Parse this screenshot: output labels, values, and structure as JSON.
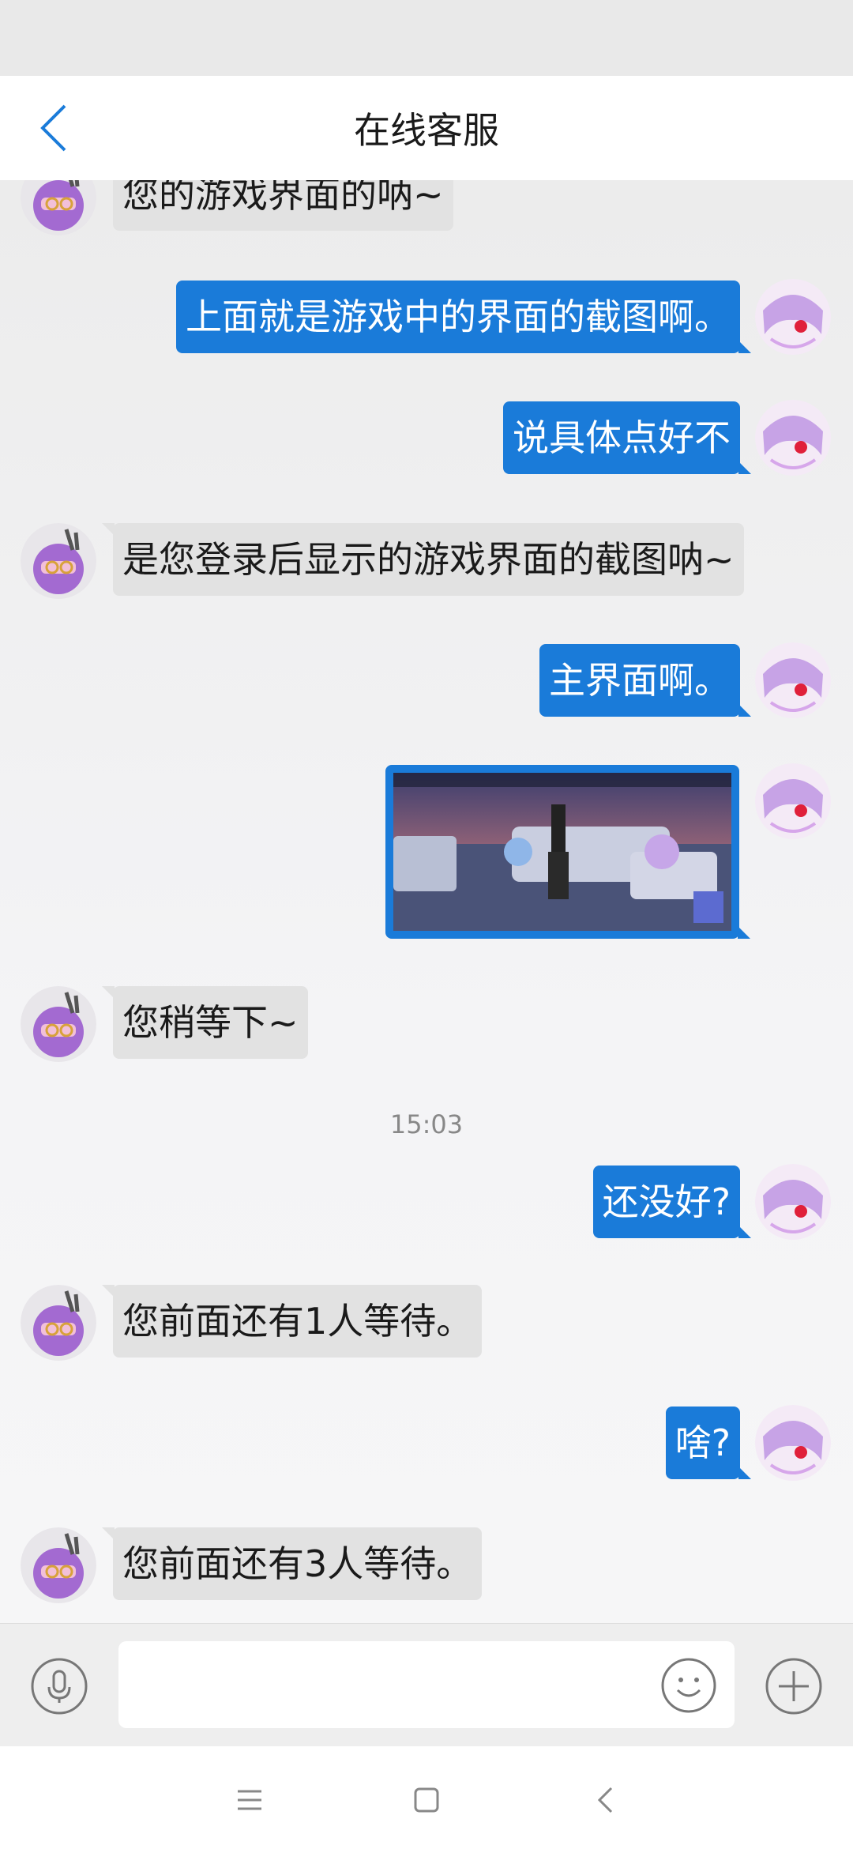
{
  "header": {
    "title": "在线客服"
  },
  "messages": [
    {
      "side": "left",
      "text": "您的游戏界面的呐~"
    },
    {
      "side": "right",
      "text": "上面就是游戏中的界面的截图啊。"
    },
    {
      "side": "right",
      "text": "说具体点好不"
    },
    {
      "side": "left",
      "text": "是您登录后显示的游戏界面的截图呐~"
    },
    {
      "side": "right",
      "text": "主界面啊。"
    },
    {
      "side": "right",
      "type": "image"
    },
    {
      "side": "left",
      "text": "您稍等下~"
    },
    {
      "timestamp": "15:03"
    },
    {
      "side": "right",
      "text": "还没好?"
    },
    {
      "side": "left",
      "text": "您前面还有1人等待。"
    },
    {
      "side": "right",
      "text": "啥?"
    },
    {
      "side": "left",
      "text": "您前面还有3人等待。"
    }
  ],
  "input": {
    "value": "",
    "placeholder": ""
  },
  "icons": {
    "back": "chevron-left-icon",
    "mic": "microphone-icon",
    "emoji": "smiley-icon",
    "plus": "plus-icon",
    "nav_menu": "menu-icon",
    "nav_home": "home-square-icon",
    "nav_back": "back-triangle-icon"
  },
  "colors": {
    "accent": "#1a7bd9",
    "bubble_left": "#e2e2e2",
    "header_bg": "#ffffff",
    "page_bg": "#ececec"
  }
}
